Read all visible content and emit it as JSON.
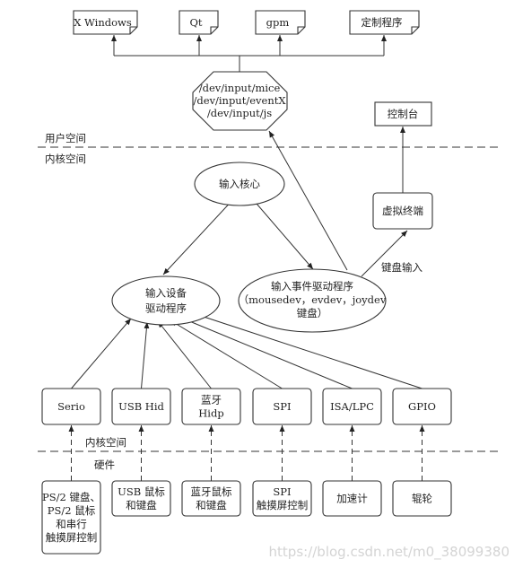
{
  "apps": [
    "X Windows",
    "Qt",
    "gpm",
    "定制程序"
  ],
  "device_nodes": [
    "/dev/input/mice",
    "/dev/input/eventX",
    "/dev/input/js"
  ],
  "console": "控制台",
  "user_space": "用户空间",
  "kernel_space": "内核空间",
  "input_core": "输入核心",
  "virtual_terminal": "虚拟终端",
  "keyboard_input": "键盘输入",
  "input_device_driver": [
    "输入设备",
    "驱动程序"
  ],
  "event_driver": [
    "输入事件驱动程序",
    "（mousedev，evdev，joydev",
    "键盘）"
  ],
  "buses": [
    [
      "Serio"
    ],
    [
      "USB Hid"
    ],
    [
      "蓝牙",
      "Hidp"
    ],
    [
      "SPI"
    ],
    [
      "ISA/LPC"
    ],
    [
      "GPIO"
    ]
  ],
  "kernel_space_lower": "内核空间",
  "hardware": "硬件",
  "devices": [
    [
      "PS/2 键盘、",
      "PS/2 鼠标",
      "和串行",
      "触摸屏控制"
    ],
    [
      "USB 鼠标",
      "和键盘"
    ],
    [
      "蓝牙鼠标",
      "和键盘"
    ],
    [
      "SPI",
      "触摸屏控制"
    ],
    [
      "加速计"
    ],
    [
      "辊轮"
    ]
  ],
  "watermark": "https://blog.csdn.net/m0_38099380"
}
